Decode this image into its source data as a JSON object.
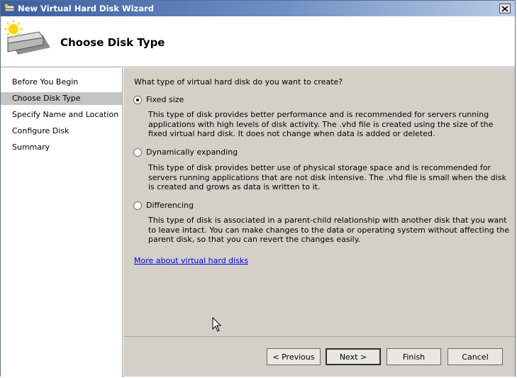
{
  "window": {
    "title": "New Virtual Hard Disk Wizard"
  },
  "header": {
    "title": "Choose Disk Type"
  },
  "sidebar": {
    "items": [
      {
        "label": "Before You Begin",
        "selected": false
      },
      {
        "label": "Choose Disk Type",
        "selected": true
      },
      {
        "label": "Specify Name and Location",
        "selected": false
      },
      {
        "label": "Configure Disk",
        "selected": false
      },
      {
        "label": "Summary",
        "selected": false
      }
    ]
  },
  "content": {
    "question": "What type of virtual hard disk do you want to create?",
    "options": [
      {
        "label": "Fixed size",
        "checked": true,
        "description": "This type of disk provides better performance and is recommended for servers running applications with high levels of disk activity. The .vhd file is created using the size of the fixed virtual hard disk. It does not change when data is added or deleted."
      },
      {
        "label": "Dynamically expanding",
        "checked": false,
        "description": "This type of disk provides better use of physical storage space and is recommended for servers running applications that are not disk intensive. The .vhd file is small when the disk is created and grows as data is written to it."
      },
      {
        "label": "Differencing",
        "checked": false,
        "description": "This type of disk is associated in a parent-child relationship with another disk that you want to leave intact. You can make changes to the data or operating system without affecting the parent disk, so that you can revert the changes easily."
      }
    ],
    "link": "More about virtual hard disks"
  },
  "footer": {
    "previous": "< Previous",
    "next": "Next >",
    "finish": "Finish",
    "cancel": "Cancel"
  },
  "icons": {
    "title": "disk-icon",
    "header": "hard-disk-icon",
    "close": "close-icon"
  },
  "colors": {
    "titlebar": "#3a5ea2",
    "panel": "#d4d0c8",
    "selected": "#c4c4c4",
    "link": "#0000ee"
  }
}
